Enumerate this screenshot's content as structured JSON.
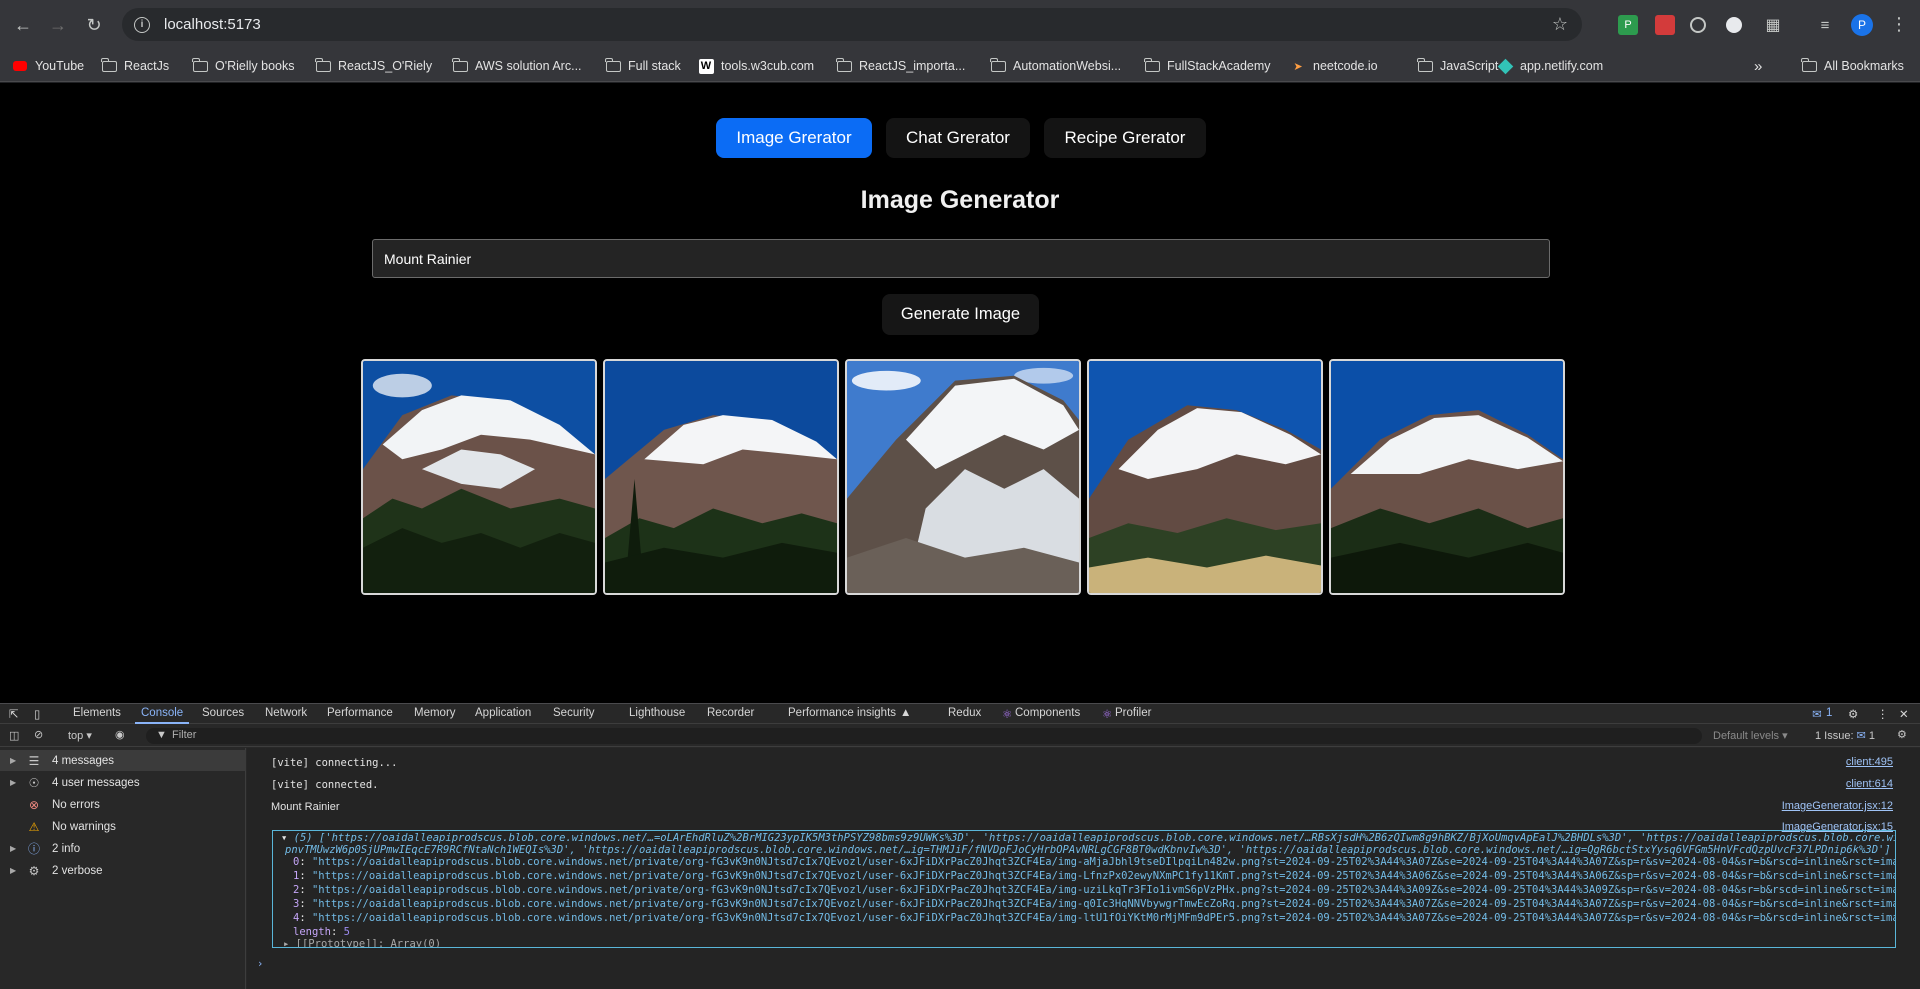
{
  "browser": {
    "url": "localhost:5173",
    "profile_initial": "P"
  },
  "bookmarks": [
    {
      "label": "YouTube",
      "icon": "youtube-icon"
    },
    {
      "label": "ReactJs",
      "icon": "folder-icon"
    },
    {
      "label": "O'Rielly books",
      "icon": "folder-icon"
    },
    {
      "label": "ReactJS_O'Riely",
      "icon": "folder-icon"
    },
    {
      "label": "AWS solution Arc...",
      "icon": "folder-icon"
    },
    {
      "label": "Full stack",
      "icon": "folder-icon"
    },
    {
      "label": "tools.w3cub.com",
      "icon": "w3cub-icon"
    },
    {
      "label": "ReactJS_importa...",
      "icon": "folder-icon"
    },
    {
      "label": "AutomationWebsi...",
      "icon": "folder-icon"
    },
    {
      "label": "FullStackAcademy",
      "icon": "folder-icon"
    },
    {
      "label": "neetcode.io",
      "icon": "rocket-icon"
    },
    {
      "label": "JavaScript",
      "icon": "folder-icon"
    },
    {
      "label": "app.netlify.com",
      "icon": "netlify-icon"
    }
  ],
  "all_bookmarks": "All Bookmarks",
  "overflow_glyph": "»",
  "app": {
    "tabs": [
      {
        "label": "Image Grerator",
        "active": true
      },
      {
        "label": "Chat Grerator",
        "active": false
      },
      {
        "label": "Recipe Grerator",
        "active": false
      }
    ],
    "title": "Image Generator",
    "prompt_value": "Mount Rainier",
    "generate_label": "Generate Image",
    "images_count": 5
  },
  "devtools": {
    "tabs": [
      "Elements",
      "Console",
      "Sources",
      "Network",
      "Performance",
      "Memory",
      "Application",
      "Security",
      "Lighthouse",
      "Recorder",
      "Performance insights",
      "Redux",
      "Components",
      "Profiler"
    ],
    "active_tab": "Console",
    "issues_badge": "1",
    "context": "top",
    "filter_placeholder": "Filter",
    "default_levels": "Default levels",
    "issue_label": "1 Issue:",
    "issue_count": "1",
    "sidebar": [
      {
        "label": "4 messages",
        "icon": "list-icon",
        "expandable": true
      },
      {
        "label": "4 user messages",
        "icon": "user-icon",
        "expandable": true
      },
      {
        "label": "No errors",
        "icon": "error-icon",
        "expandable": false
      },
      {
        "label": "No warnings",
        "icon": "warning-icon",
        "expandable": false
      },
      {
        "label": "2 info",
        "icon": "info-icon",
        "expandable": true
      },
      {
        "label": "2 verbose",
        "icon": "bug-icon",
        "expandable": true
      }
    ],
    "logs": [
      {
        "text": "[vite] connecting...",
        "source": "client:495"
      },
      {
        "text": "[vite] connected.",
        "source": "client:614"
      },
      {
        "text": "Mount Rainier",
        "source": "ImageGenerator.jsx:12"
      },
      {
        "text": "",
        "source": "ImageGenerator.jsx:15"
      }
    ],
    "array_summary_1": "(5) ['https://oaidalleapiprodscus.blob.core.windows.net/…=oLArEhdRluZ%2BrMIG23ypIK5M3thPSYZ98bms9z9UWKs%3D', 'https://oaidalleapiprodscus.blob.core.windows.net/…RBsXjsdH%2B6zQIwm8g9hBKZ/BjXoUmqvApEalJ%2BHDLs%3D', 'https://oaidalleapiprodscus.blob.core.windows.net/…ig=mw",
    "array_summary_2": "pnvTMUwzW6p0SjUPmwIEqcE7R9RCfNtaNch1WEQIs%3D', 'https://oaidalleapiprodscus.blob.core.windows.net/…ig=THMJiF/fNVDpFJoCyHrbOPAvNRLgCGF8BT0wdKbnvIw%3D', 'https://oaidalleapiprodscus.blob.core.windows.net/…ig=QgR6bctStxYysq6VFGm5HnVFcdQzpUvcF37LPDnip6k%3D']",
    "array_items": [
      {
        "index": "0",
        "value": "\"https://oaidalleapiprodscus.blob.core.windows.net/private/org-fG3vK9n0NJtsd7cIx7QEvozl/user-6xJFiDXrPacZ0Jhqt3ZCF4Ea/img-aMjaJbhl9tseDIlpqiLn482w.png?st=2024-09-25T02%3A44%3A07Z&se=2024-09-25T04%3A44%3A07Z&sp=r&sv=2024-08-04&sr=b&rscd=inline&rsct=image/png&skoid=d5"
      },
      {
        "index": "1",
        "value": "\"https://oaidalleapiprodscus.blob.core.windows.net/private/org-fG3vK9n0NJtsd7cIx7QEvozl/user-6xJFiDXrPacZ0Jhqt3ZCF4Ea/img-LfnzPx02ewyNXmPC1fy11KmT.png?st=2024-09-25T02%3A44%3A06Z&se=2024-09-25T04%3A44%3A06Z&sp=r&sv=2024-08-04&sr=b&rscd=inline&rsct=image/png&skoid=d5"
      },
      {
        "index": "2",
        "value": "\"https://oaidalleapiprodscus.blob.core.windows.net/private/org-fG3vK9n0NJtsd7cIx7QEvozl/user-6xJFiDXrPacZ0Jhqt3ZCF4Ea/img-uziLkqTr3FIo1ivmS6pVzPHx.png?st=2024-09-25T02%3A44%3A09Z&se=2024-09-25T04%3A44%3A09Z&sp=r&sv=2024-08-04&sr=b&rscd=inline&rsct=image/png&skoid=d5"
      },
      {
        "index": "3",
        "value": "\"https://oaidalleapiprodscus.blob.core.windows.net/private/org-fG3vK9n0NJtsd7cIx7QEvozl/user-6xJFiDXrPacZ0Jhqt3ZCF4Ea/img-q0Ic3HqNNVbywgrTmwEcZoRq.png?st=2024-09-25T02%3A44%3A07Z&se=2024-09-25T04%3A44%3A07Z&sp=r&sv=2024-08-04&sr=b&rscd=inline&rsct=image/png&skoid=d5"
      },
      {
        "index": "4",
        "value": "\"https://oaidalleapiprodscus.blob.core.windows.net/private/org-fG3vK9n0NJtsd7cIx7QEvozl/user-6xJFiDXrPacZ0Jhqt3ZCF4Ea/img-ltU1fOiYKtM0rMjMFm9dPEr5.png?st=2024-09-25T02%3A44%3A07Z&se=2024-09-25T04%3A44%3A07Z&sp=r&sv=2024-08-04&sr=b&rscd=inline&rsct=image/png&skoid=d5"
      }
    ],
    "length_key": "length",
    "length_value": "5",
    "prototype_line": "[[Prototype]]: Array(0)"
  }
}
